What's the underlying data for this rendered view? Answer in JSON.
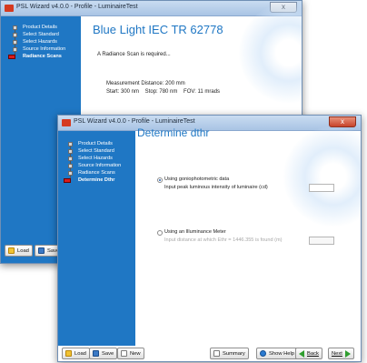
{
  "back_window": {
    "title_prefix": "PSL Wizard v4.0.0 - Profile - ",
    "title_profile": "LuminaireTest",
    "close_glyph": "x",
    "steps": [
      "Product Details",
      "Select Standard",
      "Select Hazards",
      "Source Information",
      "Radiance Scans"
    ],
    "heading": "Blue Light IEC TR 62778",
    "notice": "A Radiance Scan is required...",
    "measurement_distance": "Measurement Distance: 200 mm",
    "scan_params": "Start: 300 nm    Stop: 780 nm    FOV: 11 mrads",
    "load_label": "Load",
    "save_label": "Save"
  },
  "front_window": {
    "title_prefix": "PSL Wizard v4.0.0 - Profile - ",
    "title_profile": "LuminaireTest",
    "close_glyph": "x",
    "steps": [
      "Product Details",
      "Select Standard",
      "Select Hazards",
      "Source Information",
      "Radiance Scans",
      "Determine Dthr"
    ],
    "heading": "Determine dthr",
    "option1_label": "Using goniophotometric data",
    "option1_prompt": "Input peak luminous intensity of luminaire (cd)",
    "option2_label": "Using an Illuminance Meter",
    "option2_prompt": "Input distance at which Ethr = 1446.355 is found (m)",
    "load_label": "Load",
    "save_label": "Save",
    "new_label": "New",
    "summary_label": "Summary",
    "help_label": "Show Help",
    "back_label": "Back",
    "next_label": "Next"
  },
  "colors": {
    "sidebar": "#1f77c4",
    "accent_title": "#1f77c4",
    "active_step": "#d81c1c"
  }
}
